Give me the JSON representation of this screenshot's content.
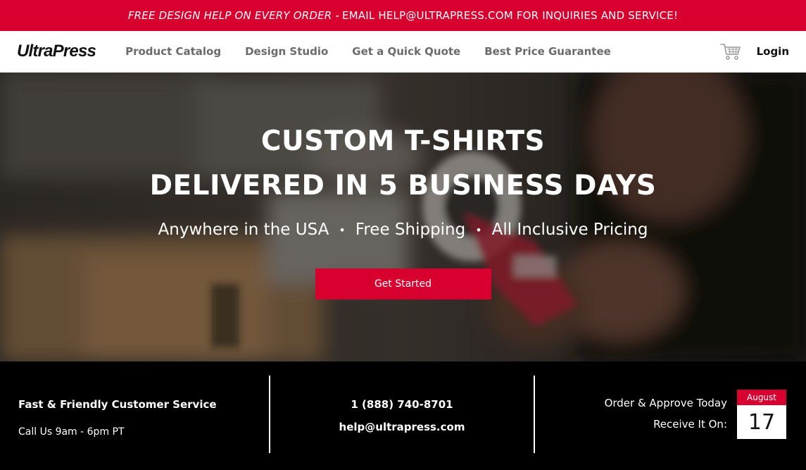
{
  "promo": {
    "emphasis": "FREE DESIGN HELP ON EVERY ORDER -",
    "text": "EMAIL HELP@ULTRAPRESS.COM FOR INQUIRIES AND SERVICE!"
  },
  "header": {
    "logo": "UltraPress",
    "nav": [
      "Product Catalog",
      "Design Studio",
      "Get a Quick Quote",
      "Best Price Guarantee"
    ],
    "login": "Login",
    "cart_icon": "shopping-cart-icon"
  },
  "hero": {
    "title_line1": "CUSTOM T-SHIRTS",
    "title_line2": "DELIVERED IN 5 BUSINESS DAYS",
    "subtitle": [
      "Anywhere in the USA",
      "Free Shipping",
      "All Inclusive Pricing"
    ],
    "separator": "•",
    "cta": "Get Started"
  },
  "info": {
    "service_title": "Fast & Friendly Customer Service",
    "service_hours": "Call Us 9am - 6pm PT",
    "phone": "1 (888) 740-8701",
    "email": "help@ultrapress.com",
    "order_text": "Order & Approve Today",
    "receive_text": "Receive It On:",
    "calendar": {
      "month": "August",
      "day": "17"
    }
  },
  "colors": {
    "brand_red": "#d8002f",
    "black": "#000000",
    "white": "#ffffff"
  }
}
